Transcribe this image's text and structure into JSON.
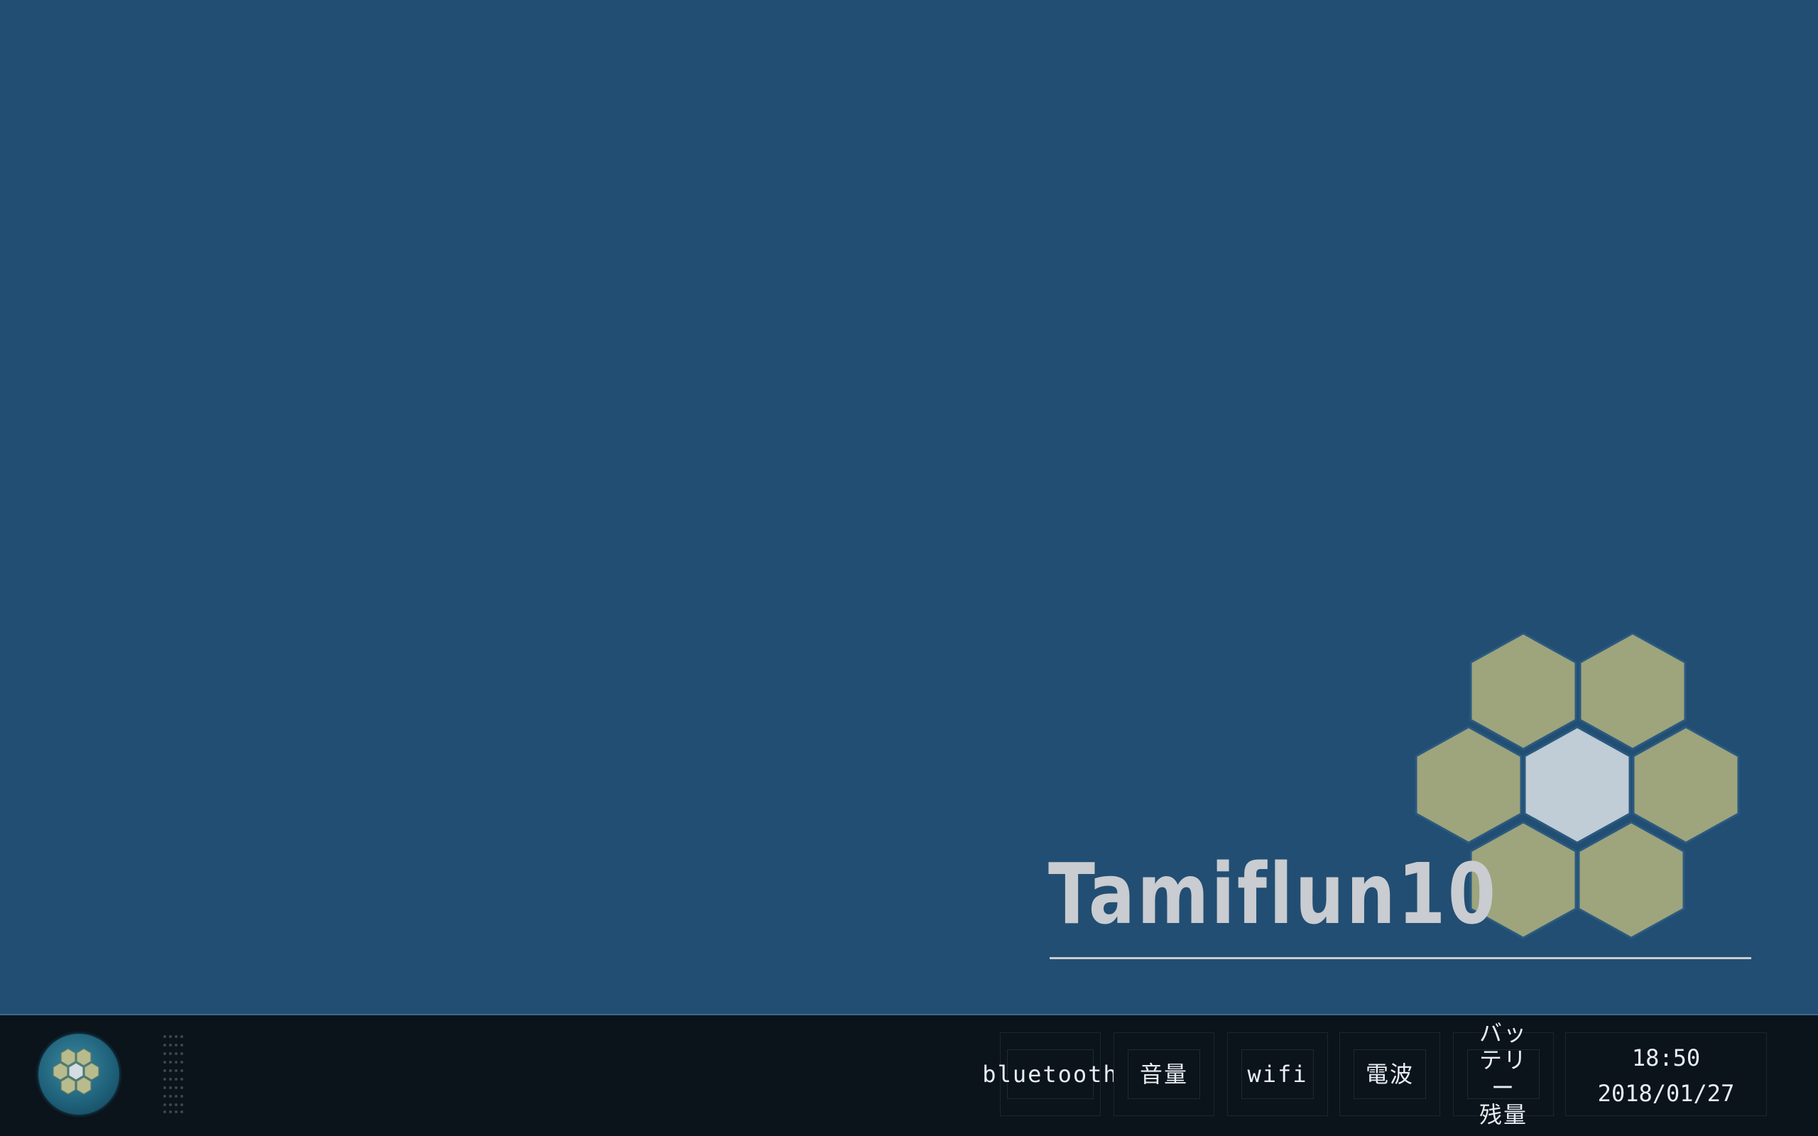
{
  "desktop": {
    "brand_title": "Tamiflun10",
    "background_color": "#224e73",
    "logo_icon": "hexagon-flower-icon",
    "logo_colors": {
      "outer": "#9ea47c",
      "center": "#c0ccd6",
      "stroke": "#2a5a80"
    }
  },
  "taskbar": {
    "start_icon": "hexagon-flower-icon",
    "grip_icon": "grip-dots-icon",
    "tray": {
      "bluetooth_label": "bluetooth",
      "volume_label": "音量",
      "wifi_label": "wifi",
      "signal_label": "電波",
      "battery_label": "バッテリー\n残量"
    },
    "clock": {
      "time": "18:50",
      "date": "2018/01/27"
    }
  }
}
